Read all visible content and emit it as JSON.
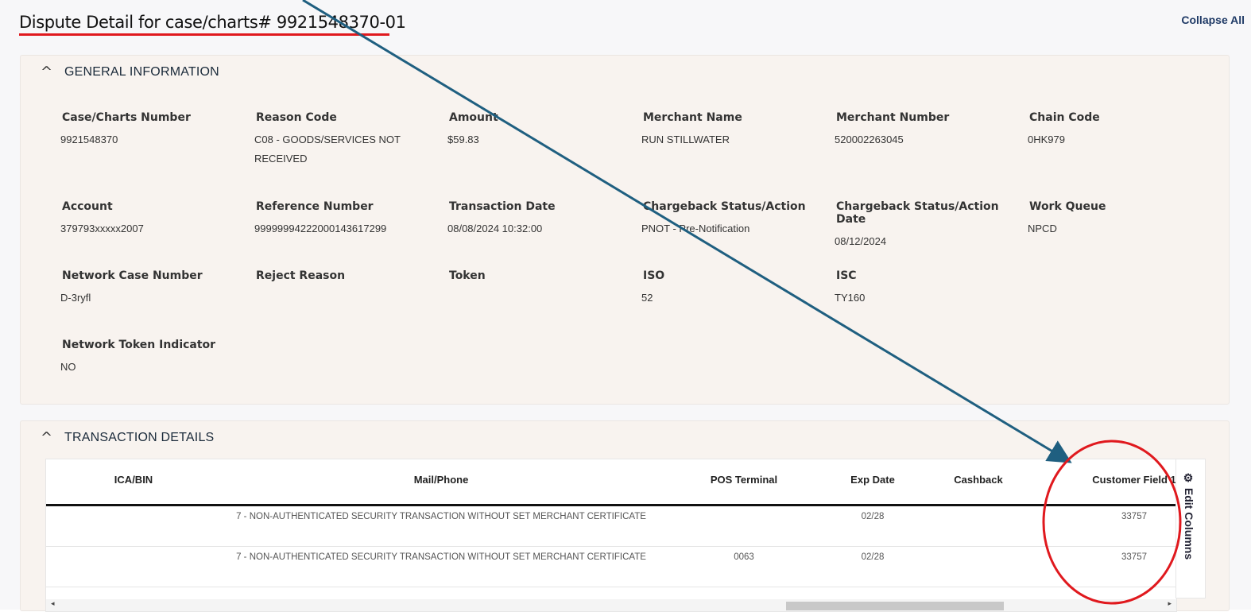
{
  "page": {
    "title": "Dispute Detail for case/charts# 9921548370-01",
    "collapse_all": "Collapse All"
  },
  "general": {
    "title": "GENERAL INFORMATION",
    "chevron": "^",
    "fields": [
      {
        "label": "Case/Charts Number",
        "value": "9921548370"
      },
      {
        "label": "Reason Code",
        "value": "C08 - GOODS/SERVICES NOT RECEIVED"
      },
      {
        "label": "Amount",
        "value": "$59.83"
      },
      {
        "label": "Merchant Name",
        "value": "RUN STILLWATER"
      },
      {
        "label": "Merchant Number",
        "value": "520002263045"
      },
      {
        "label": "Chain Code",
        "value": "0HK979"
      },
      {
        "label": "Account",
        "value": "379793xxxxx2007"
      },
      {
        "label": "Reference Number",
        "value": "99999994222000143617299"
      },
      {
        "label": "Transaction Date",
        "value": "08/08/2024 10:32:00"
      },
      {
        "label": "Chargeback Status/Action",
        "value": "PNOT - Pre-Notification"
      },
      {
        "label": "Chargeback Status/Action Date",
        "value": "08/12/2024"
      },
      {
        "label": "Work Queue",
        "value": "NPCD"
      },
      {
        "label": "Network Case Number",
        "value": "D-3ryfl"
      },
      {
        "label": "Reject Reason",
        "value": ""
      },
      {
        "label": "Token",
        "value": ""
      },
      {
        "label": "ISO",
        "value": "52"
      },
      {
        "label": "ISC",
        "value": "TY160"
      },
      {
        "label": "Network Token Indicator",
        "value": "NO"
      }
    ]
  },
  "transactions": {
    "title": "TRANSACTION DETAILS",
    "chevron": "^",
    "columns": [
      "ICA/BIN",
      "Mail/Phone",
      "POS Terminal",
      "Exp Date",
      "Cashback",
      "Customer Field 1"
    ],
    "rows": [
      [
        "",
        "7 - NON-AUTHENTICATED SECURITY TRANSACTION WITHOUT SET MERCHANT CERTIFICATE",
        "",
        "02/28",
        "",
        "33757"
      ],
      [
        "",
        "7 - NON-AUTHENTICATED SECURITY TRANSACTION WITHOUT SET MERCHANT CERTIFICATE",
        "0063",
        "02/28",
        "",
        "33757"
      ]
    ],
    "edit_columns": "Edit Columns",
    "edit_icon": "gear-icon",
    "scroll_left": "◂",
    "scroll_right": "▸"
  },
  "annotations": {
    "arrow_color": "#1f5f80",
    "highlight_color": "#e0191e"
  }
}
